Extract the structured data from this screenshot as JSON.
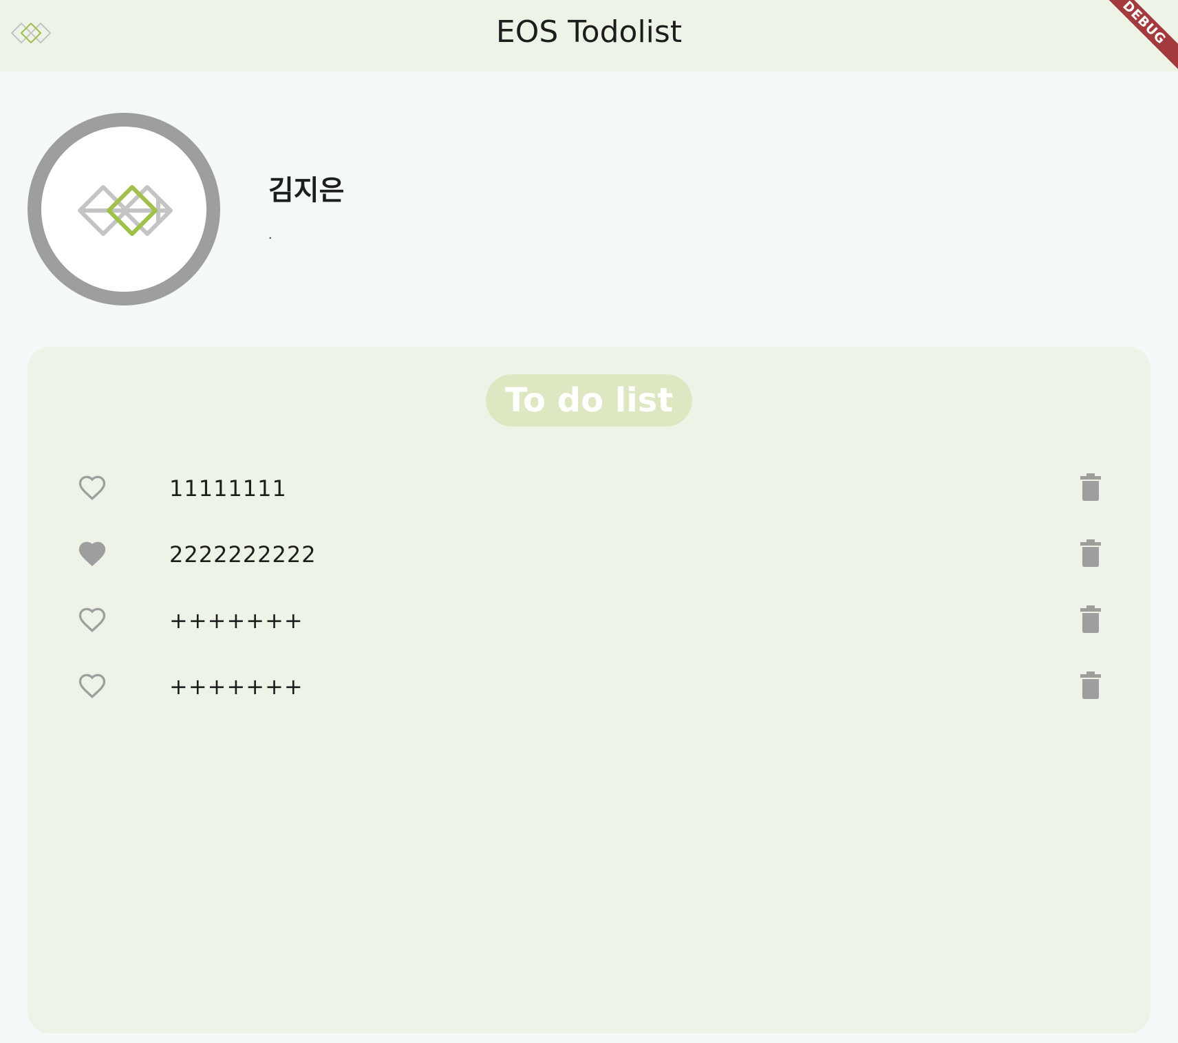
{
  "app_bar": {
    "title": "EOS Todolist",
    "logo_icon": "eos-logo-icon",
    "debug_label": "DEBUG"
  },
  "profile": {
    "name": "김지은",
    "subtitle": "."
  },
  "todo": {
    "title": "To do list",
    "items": [
      {
        "label": "11111111",
        "favorite": false
      },
      {
        "label": "2222222222",
        "favorite": true
      },
      {
        "label": "+++++++",
        "favorite": false
      },
      {
        "label": "+++++++",
        "favorite": false
      }
    ]
  },
  "colors": {
    "app_bar_bg": "#eef3e7",
    "page_bg": "#f4f8f8",
    "card_bg": "#eef3e7",
    "title_pill": "#dde8c3",
    "logo_accent": "#9fc14a",
    "icon_gray": "#9e9e9e",
    "debug_banner": "#a33a3e"
  }
}
